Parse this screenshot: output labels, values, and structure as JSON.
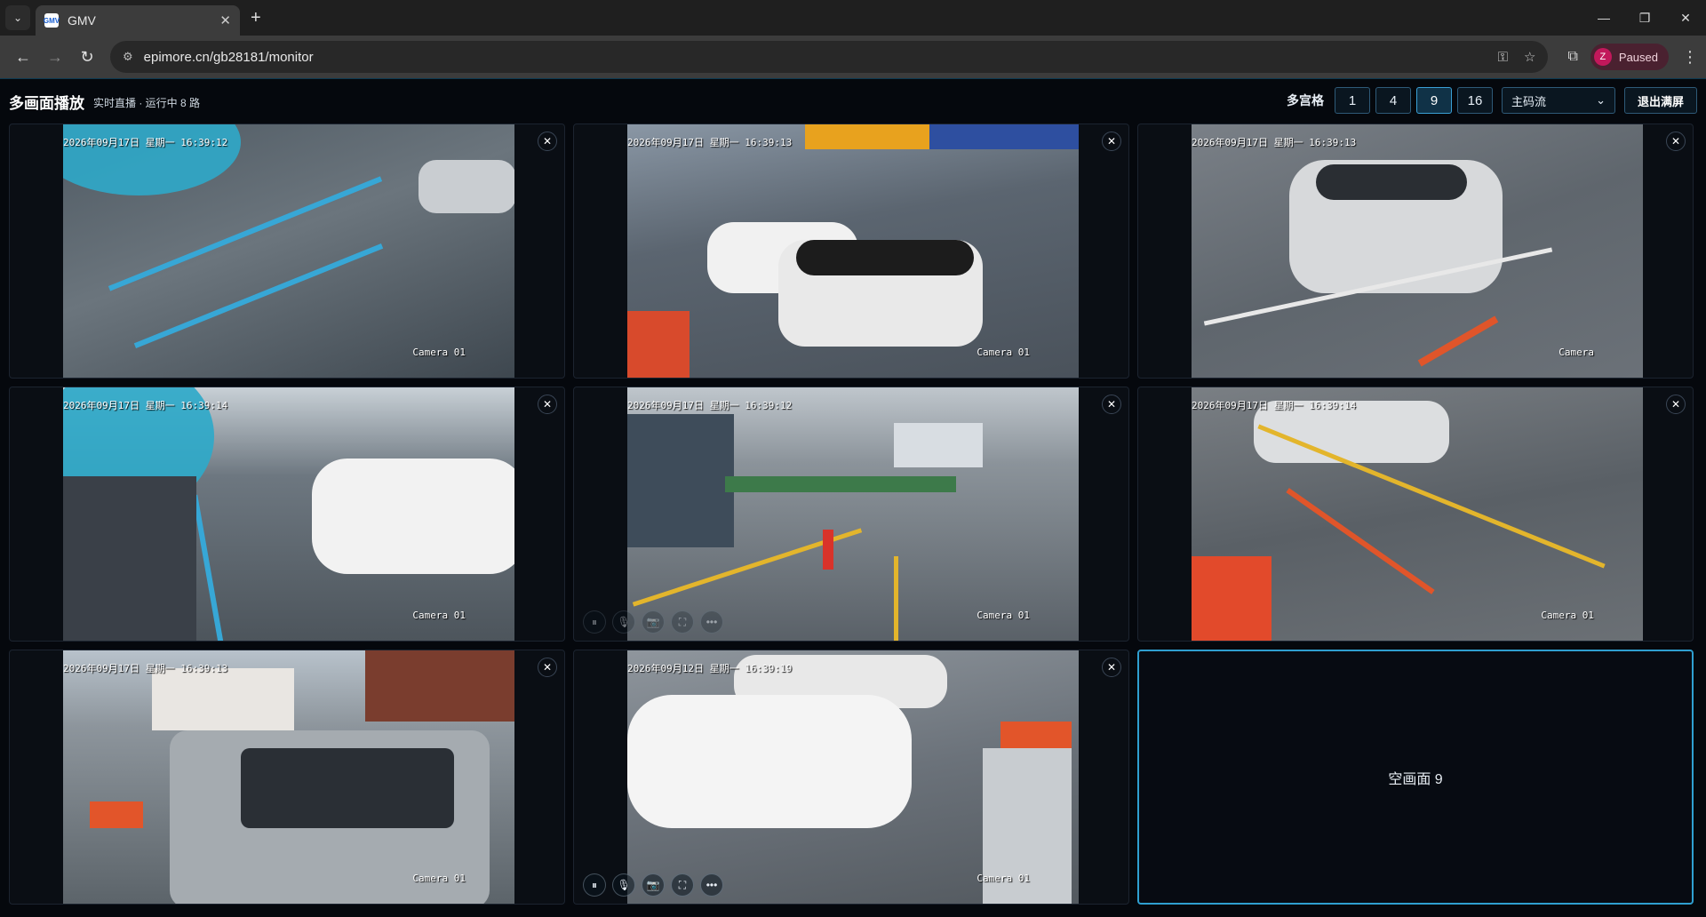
{
  "browser": {
    "tab_title": "GMV",
    "favicon_text": "GMV",
    "url": "epimore.cn/gb28181/monitor",
    "profile_initial": "Z",
    "profile_status": "Paused"
  },
  "app": {
    "title": "多画面播放",
    "subtitle": "实时直播 · 运行中 8 路",
    "grid_label": "多宫格",
    "grid_options": [
      "1",
      "4",
      "9",
      "16"
    ],
    "grid_selected": "9",
    "stream_select": "主码流",
    "exit_fullscreen": "退出满屏"
  },
  "cells": [
    {
      "time": "2026年09月17日 星期一 16:39:12",
      "camera": "Camera 01"
    },
    {
      "time": "2026年09月17日 星期一 16:39:13",
      "camera": "Camera 01"
    },
    {
      "time": "2026年09月17日 星期一 16:39:13",
      "camera": "Camera"
    },
    {
      "time": "2026年09月17日 星期一 16:39:14",
      "camera": "Camera 01"
    },
    {
      "time": "2026年09月17日 星期一 16:39:12",
      "camera": "Camera 01"
    },
    {
      "time": "2026年09月17日 星期一 16:39:14",
      "camera": "Camera 01"
    },
    {
      "time": "2026年09月17日 星期一 16:39:13",
      "camera": "Camera 01"
    },
    {
      "time": "2026年09月12日 星期一 16:39:19",
      "camera": "Camera 01"
    }
  ],
  "empty_cell_label": "空画面 9",
  "icons": {
    "close": "✕",
    "pause": "⏸",
    "mic": "🎙",
    "snapshot": "📷",
    "fullscreen": "⛶",
    "more": "•••"
  }
}
